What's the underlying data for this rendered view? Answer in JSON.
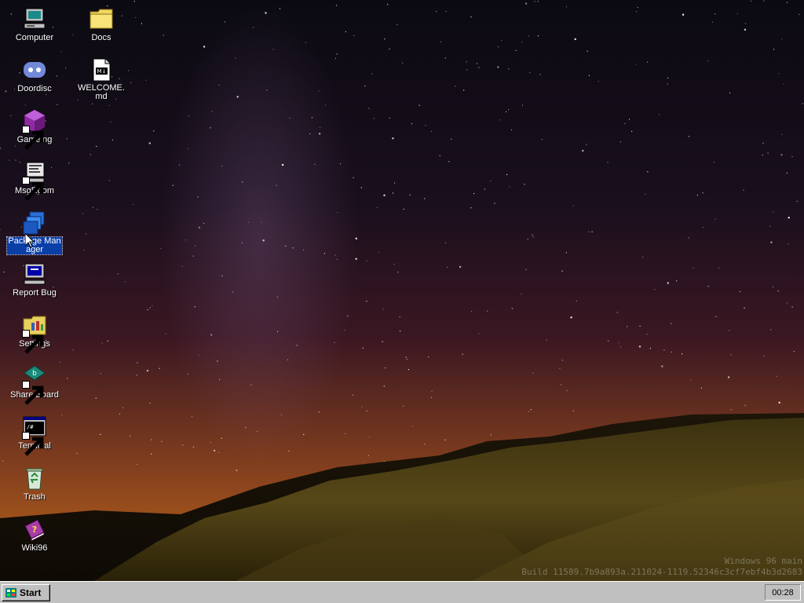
{
  "desktop": {
    "icons_col1": [
      {
        "label": "Computer",
        "icon": "computer-icon",
        "shortcut": false
      },
      {
        "label": "Doordisc",
        "icon": "discord-icon",
        "shortcut": false
      },
      {
        "label": "Gameing",
        "icon": "game-cube-icon",
        "shortcut": true
      },
      {
        "label": "MsgRoom",
        "icon": "chat-computer-icon",
        "shortcut": true
      },
      {
        "label": "Package Manager",
        "icon": "package-icon",
        "shortcut": false,
        "selected": true
      },
      {
        "label": "Report Bug",
        "icon": "bug-report-icon",
        "shortcut": false
      },
      {
        "label": "Settings",
        "icon": "settings-folder-icon",
        "shortcut": true
      },
      {
        "label": "Share Board",
        "icon": "share-board-icon",
        "shortcut": true
      },
      {
        "label": "Terminal",
        "icon": "terminal-icon",
        "shortcut": true
      },
      {
        "label": "Trash",
        "icon": "recycle-bin-icon",
        "shortcut": false
      },
      {
        "label": "Wiki96",
        "icon": "help-book-icon",
        "shortcut": false
      }
    ],
    "icons_col2": [
      {
        "label": "Docs",
        "icon": "folder-icon",
        "shortcut": false
      },
      {
        "label": "WELCOME.md",
        "icon": "markdown-file-icon",
        "shortcut": false
      }
    ],
    "build_line1": "Windows 96 main",
    "build_line2": "Build 11589.7b9a893a.211024-1119.52346c3cf7ebf4b3d2683"
  },
  "taskbar": {
    "start_label": "Start",
    "clock": "00:28"
  },
  "colors": {
    "taskbar": "#c0c0c0",
    "selection": "#0a3fa8"
  }
}
